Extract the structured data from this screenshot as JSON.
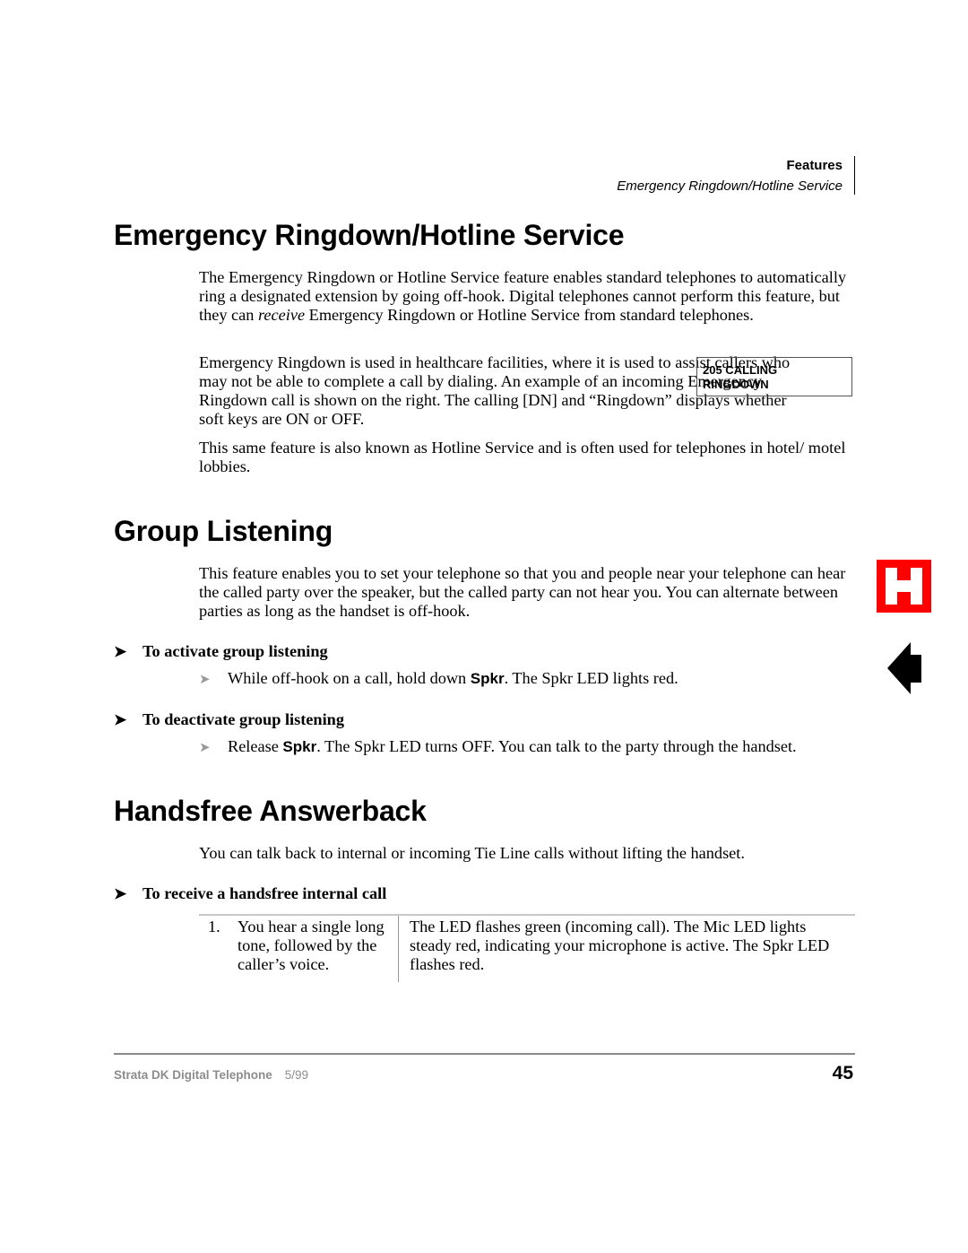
{
  "running_head": {
    "section": "Features",
    "topic": "Emergency Ringdown/Hotline Service"
  },
  "sections": [
    {
      "title": "Emergency Ringdown/Hotline Service",
      "paragraphs": [
        {
          "before": "The Emergency Ringdown or Hotline Service feature enables standard telephones to automatically ring a designated extension by going off-hook. Digital telephones cannot perform this feature, but they can ",
          "emphasis": "receive",
          "after": " Emergency Ringdown or Hotline Service from standard telephones."
        },
        {
          "text": "Emergency Ringdown is used in healthcare facilities, where it is used to assist callers who may not be able to complete a call by dialing. An example of an incoming Emergency Ringdown call is shown on the right. The calling [DN] and “Ringdown” displays whether soft keys are ON or OFF."
        },
        {
          "text": "This same feature is also known as Hotline Service and is often used for telephones in hotel/ motel lobbies."
        }
      ],
      "lcd_display": {
        "line1": "205 CALLING",
        "line2": "RINGDOWN"
      }
    },
    {
      "title": "Group Listening",
      "intro": "This feature enables you to set your telephone so that you and people near your telephone can hear the called party over the speaker, but the called party can not hear you. You can alternate between parties as long as the handset is off-hook.",
      "procedures": [
        {
          "heading": "To activate group listening",
          "step_before": "While off-hook on a call, hold down ",
          "key": "Spkr",
          "step_after": ". The Spkr LED lights red."
        },
        {
          "heading": "To deactivate group listening",
          "step_before": "Release ",
          "key": "Spkr",
          "step_after": ". The Spkr LED turns OFF. You can talk to the party through the handset."
        }
      ]
    },
    {
      "title": "Handsfree Answerback",
      "intro": "You can talk back to internal or incoming Tie Line calls without lifting the handset.",
      "procedure": {
        "heading": "To receive a handsfree internal call",
        "steps": [
          {
            "number": "1.",
            "action": "You hear a single long tone, followed by the caller’s voice.",
            "result": "The LED flashes green (incoming call). The Mic LED lights steady red, indicating your microphone is active. The Spkr LED flashes red."
          }
        ]
      }
    }
  ],
  "footer": {
    "title": "Strata DK Digital Telephone",
    "date": "5/99",
    "page_number": "45"
  },
  "side_tabs": {
    "letter": "H",
    "letter_bg_color": "#ff0000",
    "arrow_icon": "left-arrow-icon"
  },
  "glyphs": {
    "proc_arrow": "➤",
    "step_arrow": "➤"
  }
}
